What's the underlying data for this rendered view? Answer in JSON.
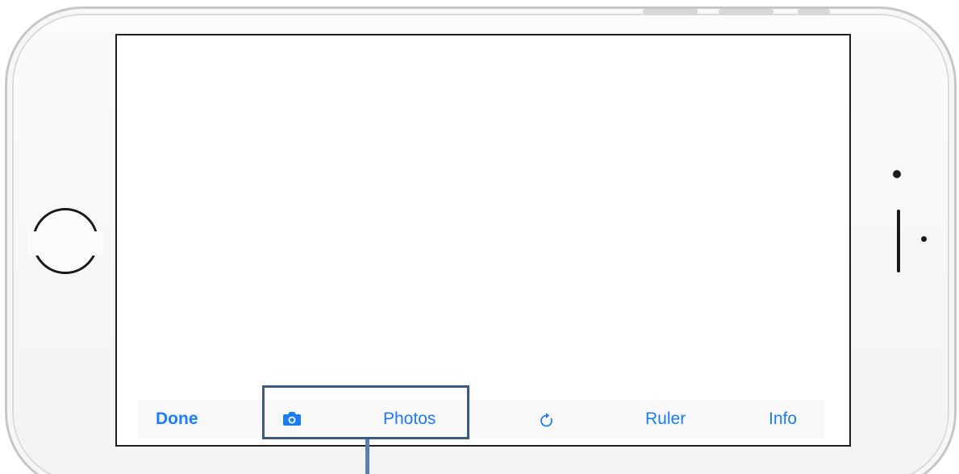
{
  "toolbar": {
    "done_label": "Done",
    "camera_icon": "camera-icon",
    "photos_label": "Photos",
    "rotate_icon": "rotate-icon",
    "ruler_label": "Ruler",
    "info_label": "Info"
  },
  "colors": {
    "accent": "#1b7cf5",
    "callout": "#3d5a80"
  }
}
